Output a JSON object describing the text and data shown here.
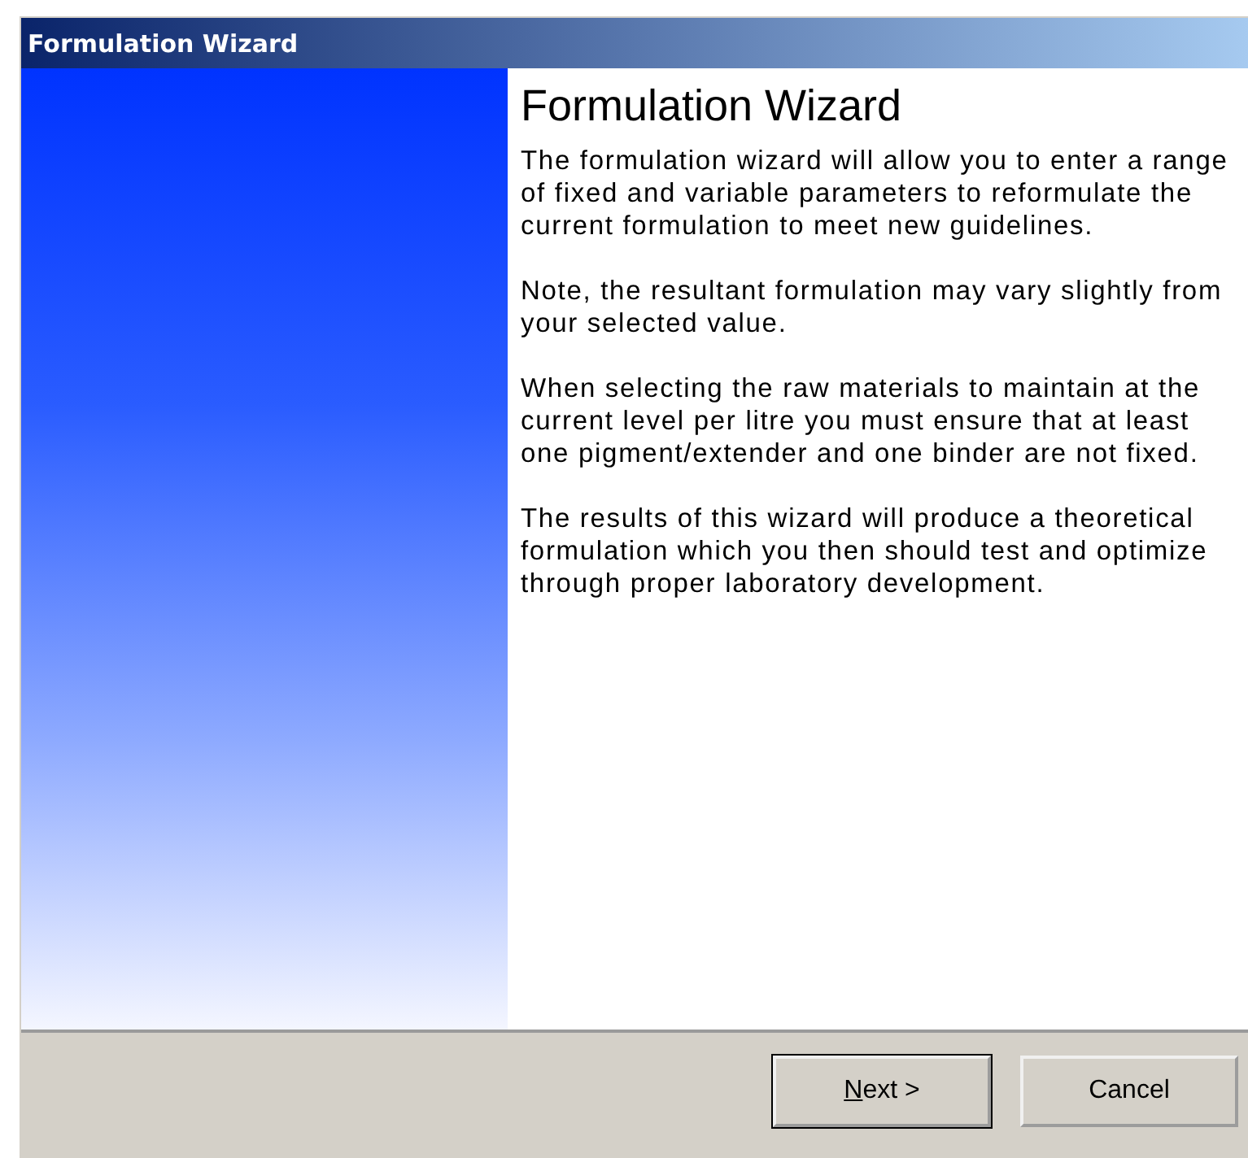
{
  "window": {
    "title": "Formulation Wizard"
  },
  "page": {
    "heading": "Formulation Wizard",
    "paragraphs": [
      "The formulation wizard will allow you to enter a range of fixed and variable parameters to reformulate the current formulation to meet new guidelines.",
      "Note, the resultant formulation may vary slightly from your selected value.",
      "When selecting the raw materials to maintain at the current level per litre you must ensure that at least one pigment/extender and one binder are not fixed.",
      "The results of this wizard will produce a theoretical formulation which you then should test and optimize through proper laboratory development."
    ]
  },
  "buttons": [
    {
      "label": "Next >",
      "mnemonic_underlined": true,
      "default": true
    },
    {
      "label": "Cancel",
      "default": false
    }
  ]
}
